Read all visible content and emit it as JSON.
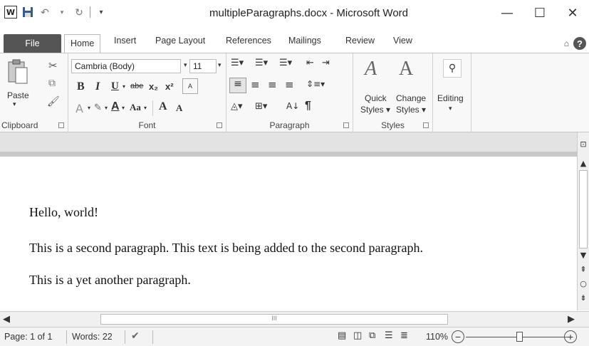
{
  "window": {
    "title": "multipleParagraphs.docx - Microsoft Word",
    "controls": {
      "minimize": "—",
      "maximize": "☐",
      "close": "✕"
    }
  },
  "qat": {
    "app_icon": "W",
    "save_icon": "save-icon",
    "undo_icon": "undo-icon",
    "redo_icon": "redo-icon"
  },
  "tabs": [
    {
      "label": "File"
    },
    {
      "label": "Home"
    },
    {
      "label": "Insert"
    },
    {
      "label": "Page Layout"
    },
    {
      "label": "References"
    },
    {
      "label": "Mailings"
    },
    {
      "label": "Review"
    },
    {
      "label": "View"
    }
  ],
  "ribbon": {
    "clipboard": {
      "paste_label": "Paste",
      "group_label": "Clipboard"
    },
    "font": {
      "font_name": "Cambria (Body)",
      "font_size": "11",
      "bold": "B",
      "italic": "I",
      "underline": "U",
      "strike": "abe",
      "subscript": "x₂",
      "superscript": "x²",
      "grow": "A",
      "shrink": "A",
      "case": "Aa",
      "group_label": "Font"
    },
    "paragraph": {
      "group_label": "Paragraph",
      "pilcrow": "¶"
    },
    "styles": {
      "quick_line1": "Quick",
      "quick_line2": "Styles ▾",
      "change_line1": "Change",
      "change_line2": "Styles ▾",
      "group_label": "Styles"
    },
    "editing": {
      "label": "Editing"
    }
  },
  "document": {
    "paragraphs": [
      "Hello, world!",
      "This is a second paragraph. This text is being added to the second paragraph.",
      "This is a yet another paragraph."
    ]
  },
  "status": {
    "page": "Page: 1 of 1",
    "words": "Words: 22",
    "zoom": "110%"
  }
}
